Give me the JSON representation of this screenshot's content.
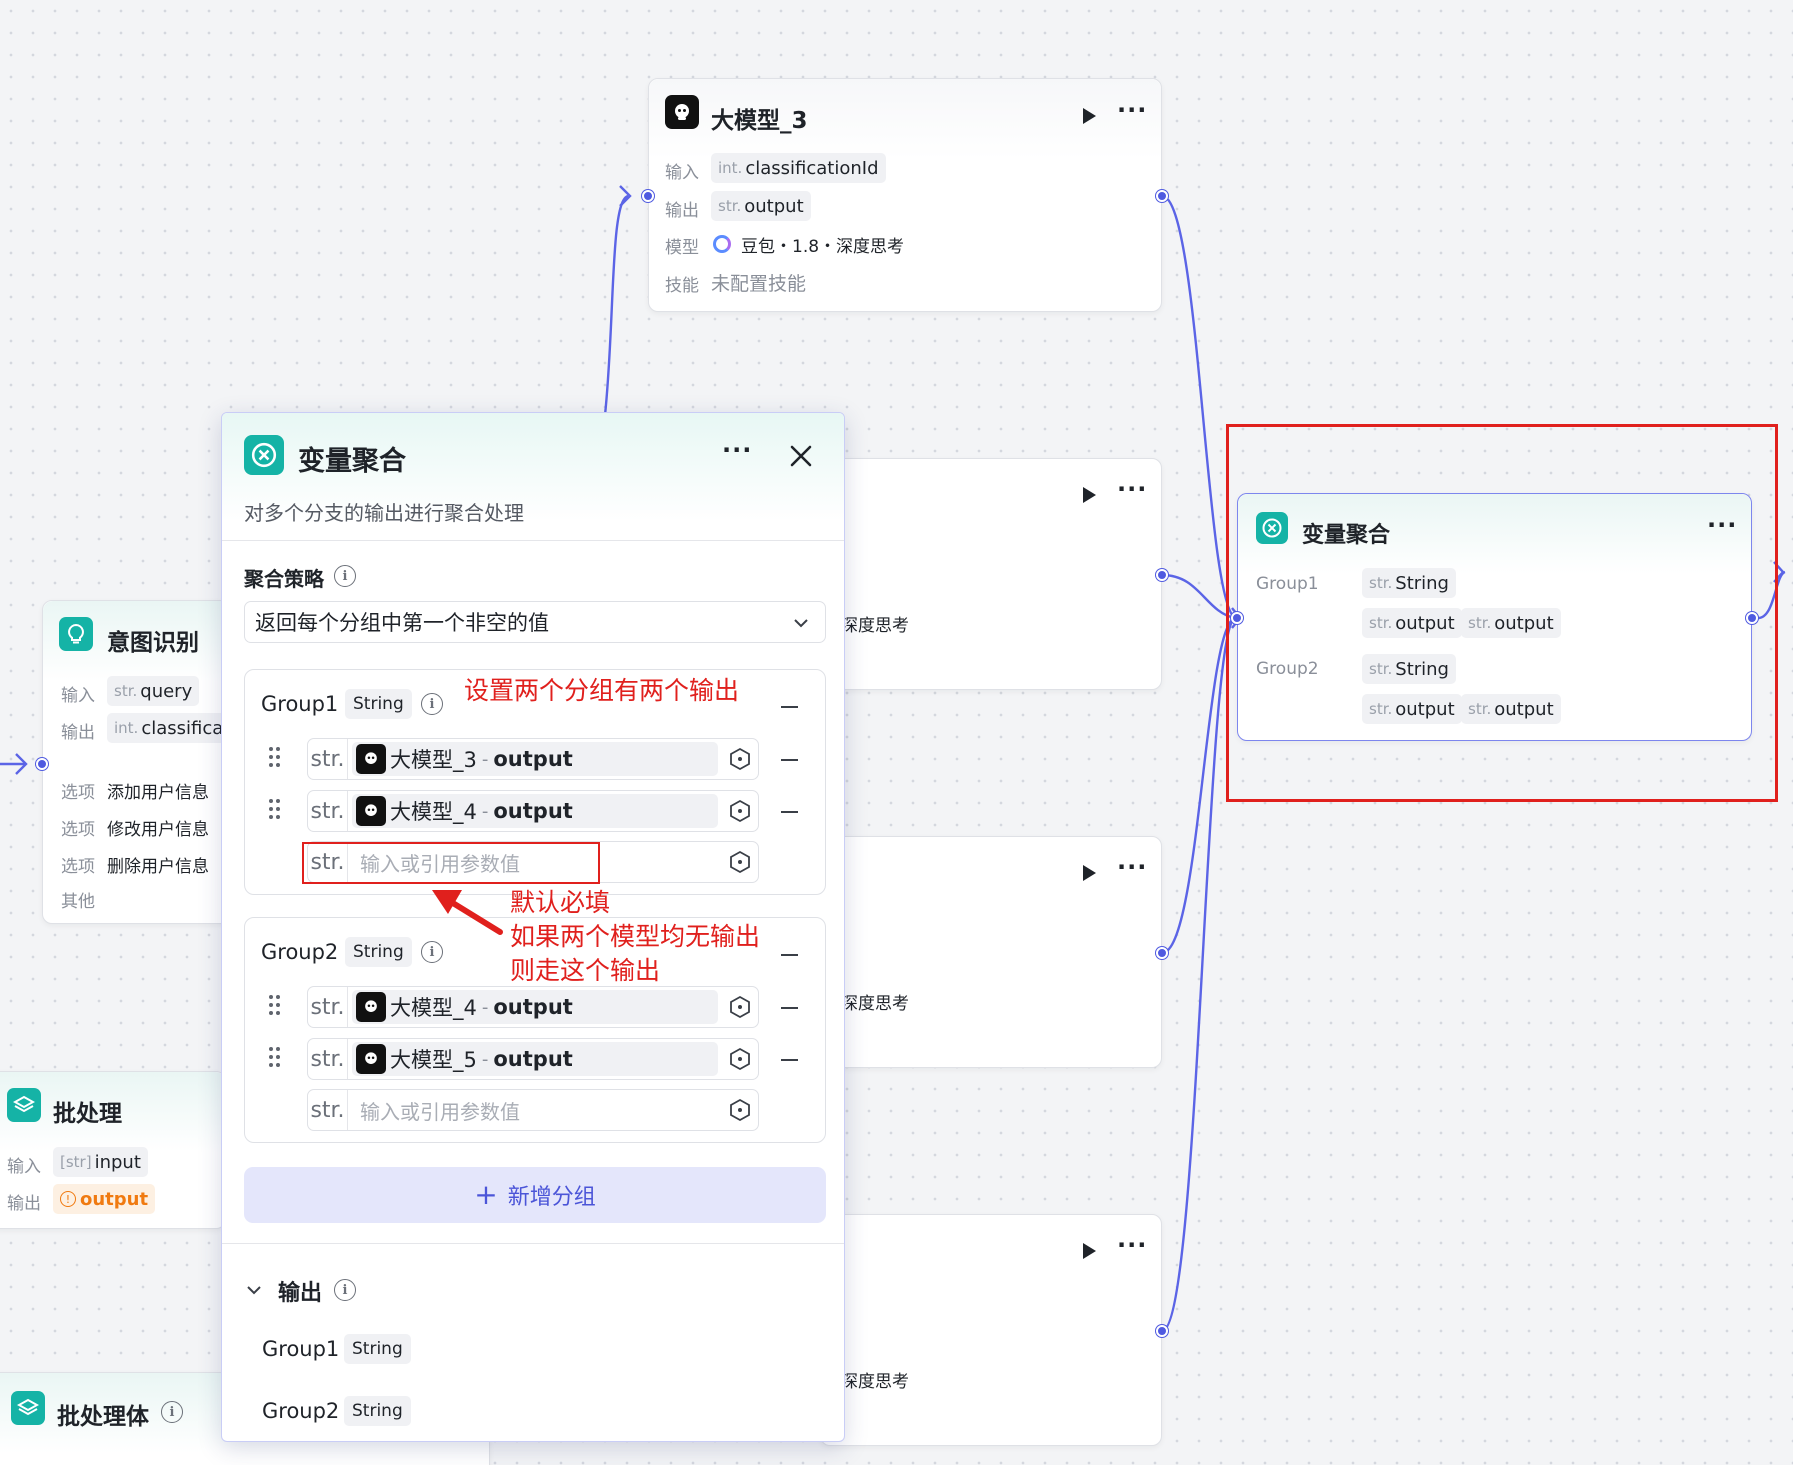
{
  "llm3": {
    "title": "大模型_3",
    "input_label": "输入",
    "input_type": "int.",
    "input_name": "classificationId",
    "output_label": "输出",
    "output_type": "str.",
    "output_name": "output",
    "model_label": "模型",
    "model_value": "豆包・1.8・深度思考",
    "skill_label": "技能",
    "skill_value": "未配置技能"
  },
  "llm_cards": {
    "partial_model": "深度思考"
  },
  "intent": {
    "title": "意图识别",
    "input_label": "输入",
    "input_type": "str.",
    "input_name": "query",
    "output_label": "输出",
    "output_type": "int.",
    "output_name": "classificati",
    "options": [
      {
        "label": "选项",
        "value": "添加用户信息"
      },
      {
        "label": "选项",
        "value": "修改用户信息"
      },
      {
        "label": "选项",
        "value": "删除用户信息"
      }
    ],
    "other_label": "其他"
  },
  "batch": {
    "title": "批处理",
    "input_label": "输入",
    "input_type": "[str]",
    "input_name": "input",
    "output_label": "输出",
    "output_name": "output"
  },
  "batch_body": {
    "title": "批处理体"
  },
  "aggregate_node": {
    "title": "变量聚合",
    "group1": "Group1",
    "group2": "Group2",
    "type_prefix": "str.",
    "type_name": "String",
    "output_name": "output"
  },
  "panel": {
    "title": "变量聚合",
    "description": "对多个分支的输出进行聚合处理",
    "strategy_label": "聚合策略",
    "strategy_value": "返回每个分组中第一个非空的值",
    "groups": [
      {
        "name": "Group1",
        "type": "String",
        "items": [
          {
            "source": "大模型_3",
            "field": "output"
          },
          {
            "source": "大模型_4",
            "field": "output"
          }
        ]
      },
      {
        "name": "Group2",
        "type": "String",
        "items": [
          {
            "source": "大模型_4",
            "field": "output"
          },
          {
            "source": "大模型_5",
            "field": "output"
          }
        ]
      }
    ],
    "str_prefix": "str.",
    "empty_placeholder": "输入或引用参数值",
    "add_group_label": "新增分组",
    "output_section_label": "输出",
    "outputs": [
      {
        "name": "Group1",
        "type": "String"
      },
      {
        "name": "Group2",
        "type": "String"
      }
    ]
  },
  "annotations": {
    "note1": "设置两个分组有两个输出",
    "note2_line1": "默认必填",
    "note2_line2": "如果两个模型均无输出",
    "note2_line3": "则走这个输出"
  },
  "colors": {
    "accent": "#4f5ae0",
    "teal": "#15b3a6",
    "annotation_red": "#e0201d"
  }
}
